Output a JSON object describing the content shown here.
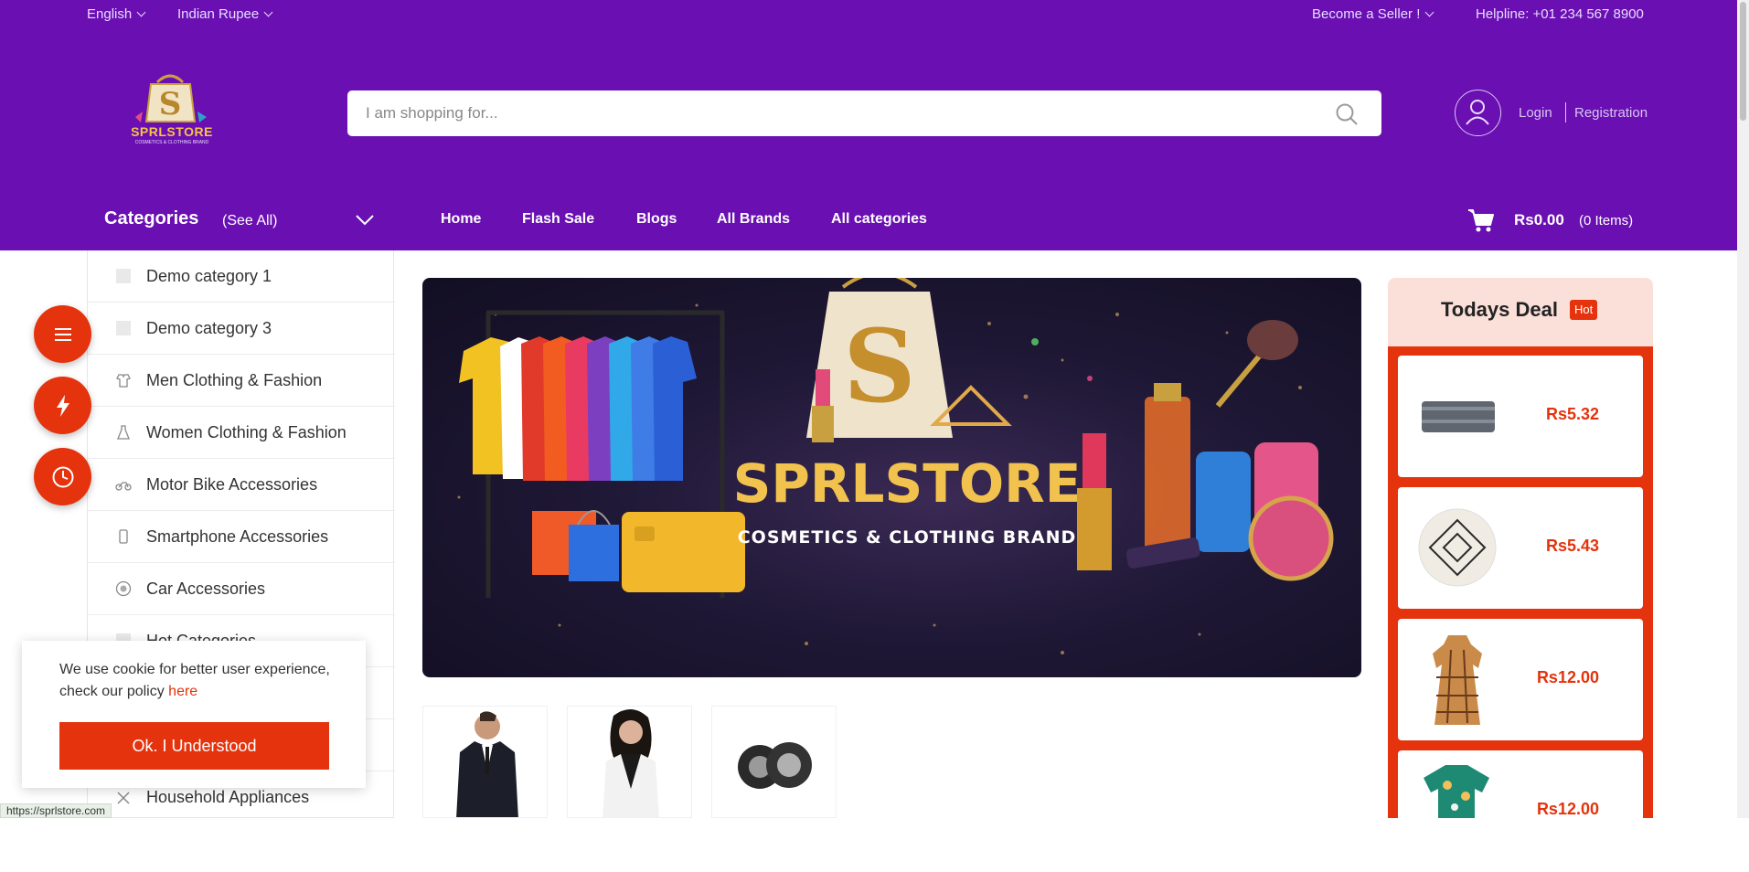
{
  "header": {
    "language": "English",
    "currency": "Indian Rupee",
    "seller_link": "Become a Seller !",
    "helpline": "Helpline: +01 234 567 8900",
    "logo_text": "SPRLSTORE",
    "logo_tagline": "COSMETICS & CLOTHING BRAND",
    "search_placeholder": "I am shopping for...",
    "login": "Login",
    "registration": "Registration"
  },
  "nav": {
    "categories_title": "Categories",
    "see_all": "(See All)",
    "links": [
      "Home",
      "Flash Sale",
      "Blogs",
      "All Brands",
      "All categories"
    ],
    "cart_total": "Rs0.00",
    "cart_items": "(0 Items)"
  },
  "sidebar": {
    "items": [
      {
        "label": "Demo category 1",
        "icon": "placeholder-icon"
      },
      {
        "label": "Demo category 3",
        "icon": "placeholder-icon"
      },
      {
        "label": "Men Clothing & Fashion",
        "icon": "men-clothing-icon"
      },
      {
        "label": "Women Clothing & Fashion",
        "icon": "dress-icon"
      },
      {
        "label": "Motor Bike Accessories",
        "icon": "motorbike-icon"
      },
      {
        "label": "Smartphone Accessories",
        "icon": "smartphone-icon"
      },
      {
        "label": "Car Accessories",
        "icon": "car-wheel-icon"
      },
      {
        "label": "Hot Categories",
        "icon": "placeholder-icon"
      },
      {
        "label": "",
        "icon": ""
      },
      {
        "label": "",
        "icon": ""
      },
      {
        "label": "Household Appliances",
        "icon": "appliance-icon"
      }
    ]
  },
  "banner": {
    "title": "SPRLSTORE",
    "subtitle": "COSMETICS & CLOTHING BRAND"
  },
  "todays_deal": {
    "title": "Todays Deal",
    "badge": "Hot",
    "items": [
      {
        "price": "Rs5.32",
        "image": "folded-scarf"
      },
      {
        "price": "Rs5.43",
        "image": "round-rug"
      },
      {
        "price": "Rs12.00",
        "image": "plaid-dress"
      },
      {
        "price": "Rs12.00",
        "image": "floral-shirt"
      }
    ]
  },
  "cookie": {
    "text": "We use cookie for better user experience, check our policy",
    "link": "here",
    "button": "Ok. I Understood"
  },
  "status_url": "https://sprlstore.com",
  "colors": {
    "brand_purple": "#6a0fb2",
    "accent_red": "#e4330d",
    "deal_header_bg": "#fbe0da"
  }
}
